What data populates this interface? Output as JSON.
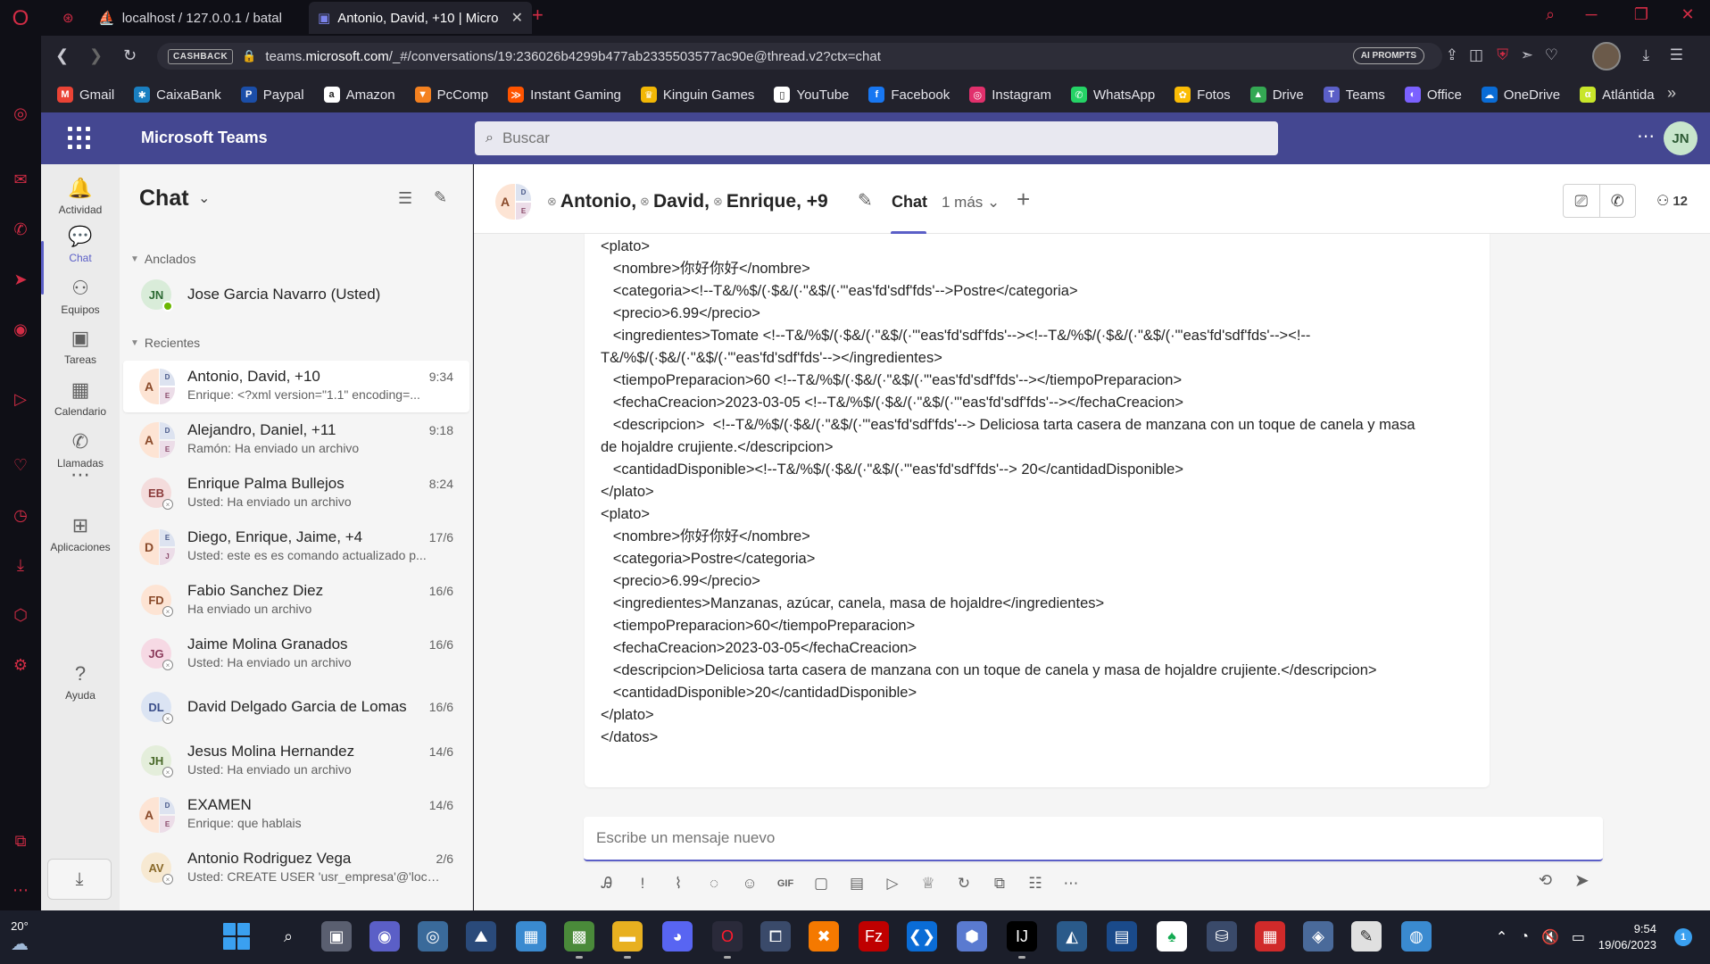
{
  "browser": {
    "tabs": [
      {
        "title": "localhost / 127.0.0.1 / batal",
        "active": false
      },
      {
        "title": "Antonio, David, +10 | Micro",
        "active": true
      }
    ],
    "cashback_label": "CASHBACK",
    "url_prefix": "teams.",
    "url_domain": "microsoft.com",
    "url_rest": "/_#/conversations/19:236026b4299b477ab2335503577ac90e@thread.v2?ctx=chat",
    "ai_prompts_label": "AI PROMPTS",
    "bookmarks": [
      {
        "label": "Gmail",
        "color": "#ea4335",
        "glyph": "M"
      },
      {
        "label": "CaixaBank",
        "color": "#1a7fc1",
        "glyph": "✱"
      },
      {
        "label": "Paypal",
        "color": "#1b4ea8",
        "glyph": "P"
      },
      {
        "label": "Amazon",
        "color": "#ffffff",
        "glyph": "a"
      },
      {
        "label": "PcComp",
        "color": "#f48120",
        "glyph": "▼"
      },
      {
        "label": "Instant Gaming",
        "color": "#ff5400",
        "glyph": "≫"
      },
      {
        "label": "Kinguin Games",
        "color": "#f2b705",
        "glyph": "♛"
      },
      {
        "label": "YouTube",
        "color": "#ffffff",
        "glyph": "▯"
      },
      {
        "label": "Facebook",
        "color": "#1877f2",
        "glyph": "f"
      },
      {
        "label": "Instagram",
        "color": "#e1306c",
        "glyph": "◎"
      },
      {
        "label": "WhatsApp",
        "color": "#25d366",
        "glyph": "✆"
      },
      {
        "label": "Fotos",
        "color": "#fbbc05",
        "glyph": "✿"
      },
      {
        "label": "Drive",
        "color": "#34a853",
        "glyph": "▲"
      },
      {
        "label": "Teams",
        "color": "#5b5fc7",
        "glyph": "T"
      },
      {
        "label": "Office",
        "color": "#7b61ff",
        "glyph": "◐"
      },
      {
        "label": "OneDrive",
        "color": "#0a6cd6",
        "glyph": "☁"
      },
      {
        "label": "Atlántida",
        "color": "#c8e62a",
        "glyph": "α"
      }
    ]
  },
  "teams": {
    "app_name": "Microsoft Teams",
    "search_placeholder": "Buscar",
    "user_initials": "JN",
    "rail": [
      {
        "label": "Actividad",
        "icon": "bell-icon",
        "glyph": "🔔"
      },
      {
        "label": "Chat",
        "icon": "chat-icon",
        "glyph": "💬"
      },
      {
        "label": "Equipos",
        "icon": "teams-icon",
        "glyph": "⚇"
      },
      {
        "label": "Tareas",
        "icon": "tasks-icon",
        "glyph": "▣"
      },
      {
        "label": "Calendario",
        "icon": "calendar-icon",
        "glyph": "▦"
      },
      {
        "label": "Llamadas",
        "icon": "phone-icon",
        "glyph": "✆"
      },
      {
        "label": "",
        "icon": "more-icon",
        "glyph": "⋯"
      },
      {
        "label": "Aplicaciones",
        "icon": "apps-icon",
        "glyph": "⊞"
      },
      {
        "label": "Ayuda",
        "icon": "help-icon",
        "glyph": "?"
      }
    ],
    "chat_list": {
      "title": "Chat",
      "pinned_label": "Anclados",
      "recent_label": "Recientes",
      "pinned": [
        {
          "name": "Jose Garcia Navarro (Usted)",
          "initials": "JN",
          "bg": "#d9ecd9",
          "fg": "#2d6a34"
        }
      ],
      "recent": [
        {
          "name": "Antonio, David, +10",
          "preview": "Enrique: <?xml version=\"1.1\" encoding=...",
          "time": "9:34",
          "group": true,
          "g1": "A",
          "g2": "D",
          "g3": "E"
        },
        {
          "name": "Alejandro, Daniel, +11",
          "preview": "Ramón: Ha enviado un archivo",
          "time": "9:18",
          "group": true,
          "g1": "A",
          "g2": "D",
          "g3": "E"
        },
        {
          "name": "Enrique Palma Bullejos",
          "preview": "Usted: Ha enviado un archivo",
          "time": "8:24",
          "initials": "EB",
          "bg": "#f4dcdc",
          "fg": "#8a3a3a"
        },
        {
          "name": "Diego, Enrique, Jaime, +4",
          "preview": "Usted: este es es comando actualizado p...",
          "time": "17/6",
          "group": true,
          "g1": "D",
          "g2": "E",
          "g3": "J"
        },
        {
          "name": "Fabio Sanchez Diez",
          "preview": "Ha enviado un archivo",
          "time": "16/6",
          "initials": "FD",
          "bg": "#fde4d4",
          "fg": "#8a4a2a"
        },
        {
          "name": "Jaime Molina Granados",
          "preview": "Usted: Ha enviado un archivo",
          "time": "16/6",
          "initials": "JG",
          "bg": "#f6d9e4",
          "fg": "#8a3a5a"
        },
        {
          "name": "David Delgado Garcia de Lomas",
          "preview": "",
          "time": "16/6",
          "initials": "DL",
          "bg": "#dbe4f3",
          "fg": "#3a4e8a"
        },
        {
          "name": "Jesus Molina Hernandez",
          "preview": "Usted: Ha enviado un archivo",
          "time": "14/6",
          "initials": "JH",
          "bg": "#e4eedb",
          "fg": "#4a6a2a"
        },
        {
          "name": "EXAMEN",
          "preview": "Enrique: que hablais",
          "time": "14/6",
          "group": true,
          "g1": "A",
          "g2": "D",
          "g3": "E"
        },
        {
          "name": "Antonio Rodriguez Vega",
          "preview": "Usted: CREATE USER 'usr_empresa'@'local...",
          "time": "2/6",
          "initials": "AV",
          "bg": "#f7e9d2",
          "fg": "#8a6a2a"
        }
      ]
    },
    "conversation": {
      "title_parts": [
        "Antonio,",
        "David,",
        "Enrique, +9"
      ],
      "tab_chat": "Chat",
      "tab_more": "1 más",
      "participant_count": "12",
      "message_lines": [
        "<plato>",
        "   <nombre>你好你好</nombre>",
        "   <categoria><!--T&/%$/(·$&/(·\"&$/(·\"'eas'fd'sdf'fds'-->Postre</categoria>",
        "   <precio>6.99</precio>",
        "   <ingredientes>Tomate <!--T&/%$/(·$&/(·\"&$/(·\"'eas'fd'sdf'fds'--><!--T&/%$/(·$&/(·\"&$/(·\"'eas'fd'sdf'fds'--><!--",
        "T&/%$/(·$&/(·\"&$/(·\"'eas'fd'sdf'fds'--></ingredientes>",
        "   <tiempoPreparacion>60 <!--T&/%$/(·$&/(·\"&$/(·\"'eas'fd'sdf'fds'--></tiempoPreparacion>",
        "   <fechaCreacion>2023-03-05 <!--T&/%$/(·$&/(·\"&$/(·\"'eas'fd'sdf'fds'--></fechaCreacion>",
        "   <descripcion>  <!--T&/%$/(·$&/(·\"&$/(·\"'eas'fd'sdf'fds'--> Deliciosa tarta casera de manzana con un toque de canela y masa",
        "de hojaldre crujiente.</descripcion>",
        "   <cantidadDisponible><!--T&/%$/(·$&/(·\"&$/(·\"'eas'fd'sdf'fds'--> 20</cantidadDisponible>",
        "</plato>",
        "<plato>",
        "   <nombre>你好你好</nombre>",
        "   <categoria>Postre</categoria>",
        "   <precio>6.99</precio>",
        "   <ingredientes>Manzanas, azúcar, canela, masa de hojaldre</ingredientes>",
        "   <tiempoPreparacion>60</tiempoPreparacion>",
        "   <fechaCreacion>2023-03-05</fechaCreacion>",
        "   <descripcion>Deliciosa tarta casera de manzana con un toque de canela y masa de hojaldre crujiente.</descripcion>",
        "   <cantidadDisponible>20</cantidadDisponible>",
        "</plato>",
        "</datos>"
      ],
      "composer_placeholder": "Escribe un mensaje nuevo"
    }
  },
  "taskbar": {
    "temperature": "20°",
    "time": "9:54",
    "date": "19/06/2023",
    "notifications": "1"
  }
}
